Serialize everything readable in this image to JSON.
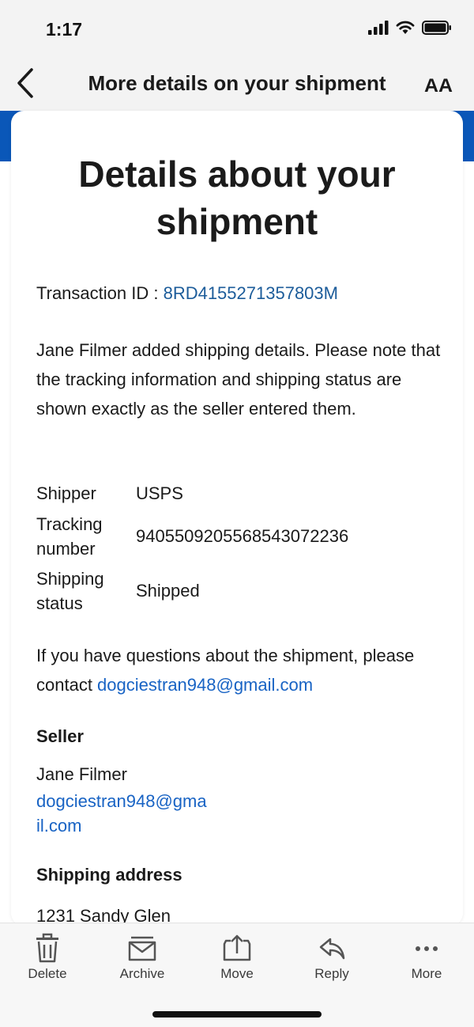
{
  "status_bar": {
    "time": "1:17"
  },
  "nav": {
    "title": "More details on your shipment",
    "text_size_label": "AA"
  },
  "card": {
    "heading_line1": "Details about your",
    "heading_line2": "shipment",
    "transaction_label": "Transaction ID : ",
    "transaction_id": "8RD4155271357803M",
    "intro": "Jane Filmer added shipping details. Please note that the tracking information and shipping status are shown exactly as the seller entered them.",
    "details": {
      "shipper_label": "Shipper",
      "shipper_value": "USPS",
      "tracking_label": "Tracking number",
      "tracking_value": "9405509205568543072236",
      "status_label": "Shipping status",
      "status_value": "Shipped"
    },
    "contact_text": "If you have questions about the shipment, please contact ",
    "contact_email": "dogciestran948@gmail.com",
    "seller_heading": "Seller",
    "seller_name": "Jane Filmer",
    "seller_email": "dogciestran948@gmail.com",
    "address_heading": "Shipping address",
    "address_line1": "1231 Sandy Glen"
  },
  "toolbar": {
    "delete": "Delete",
    "archive": "Archive",
    "move": "Move",
    "reply": "Reply",
    "more": "More"
  },
  "colors": {
    "accent_blue": "#0a57b8",
    "link_blue": "#1863c4",
    "transaction_blue": "#1c5c9a"
  }
}
